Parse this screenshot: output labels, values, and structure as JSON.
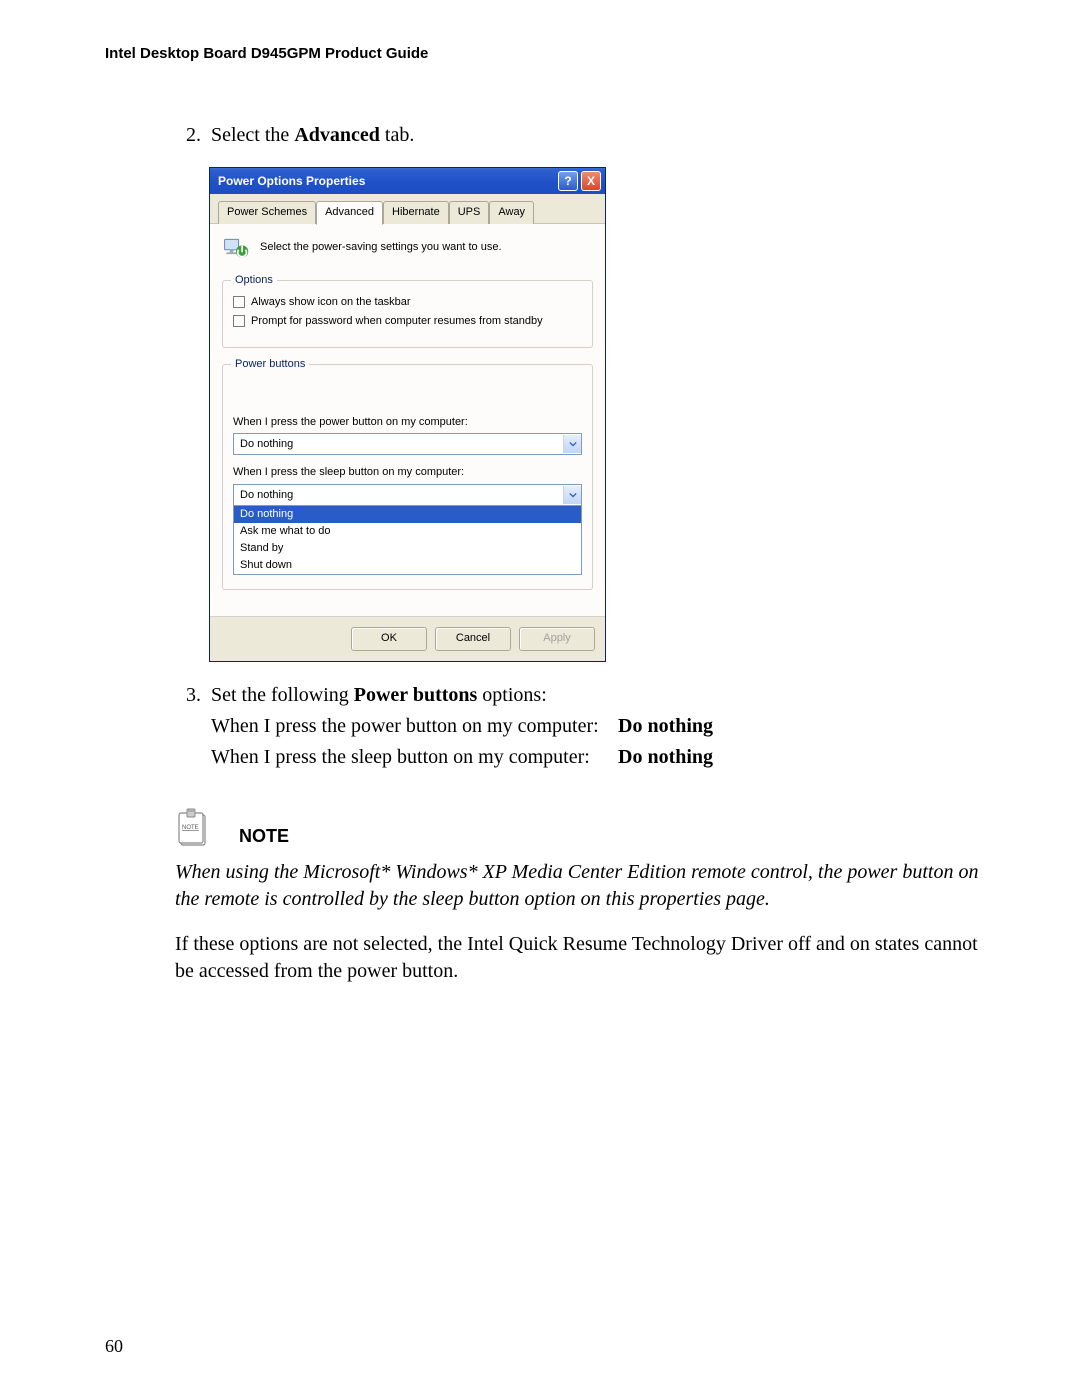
{
  "doc_header": "Intel Desktop Board D945GPM Product Guide",
  "step2": {
    "num": "2.",
    "pre": "Select the ",
    "bold": "Advanced",
    "post": " tab."
  },
  "dialog": {
    "title": "Power Options Properties",
    "help": "?",
    "close": "X",
    "tabs": [
      "Power Schemes",
      "Advanced",
      "Hibernate",
      "UPS",
      "Away"
    ],
    "desc": "Select the power-saving settings you want to use.",
    "options_legend": "Options",
    "opt1": "Always show icon on the taskbar",
    "opt2": "Prompt for password when computer resumes from standby",
    "pb_legend": "Power buttons",
    "power_label": "When I press the power button on my computer:",
    "power_value": "Do nothing",
    "sleep_label": "When I press the sleep button on my computer:",
    "sleep_value": "Do nothing",
    "sleep_options": [
      "Do nothing",
      "Ask me what to do",
      "Stand by",
      "Shut down"
    ],
    "ok": "OK",
    "cancel": "Cancel",
    "apply": "Apply"
  },
  "step3": {
    "num": "3.",
    "pre": "Set the following ",
    "bold": "Power buttons",
    "post": " options:",
    "line1_label": "When I press the power button on my computer:",
    "line1_value": "Do nothing",
    "line2_label": "When I press the sleep button on my computer:",
    "line2_value": "Do nothing"
  },
  "note": {
    "title": "NOTE",
    "body": "When using the Microsoft* Windows* XP Media Center Edition remote control, the power button on the remote is controlled by the sleep button option on this properties page.",
    "after": "If these options are not selected, the Intel Quick Resume Technology Driver off and on states cannot be accessed from the power button."
  },
  "page_number": "60"
}
